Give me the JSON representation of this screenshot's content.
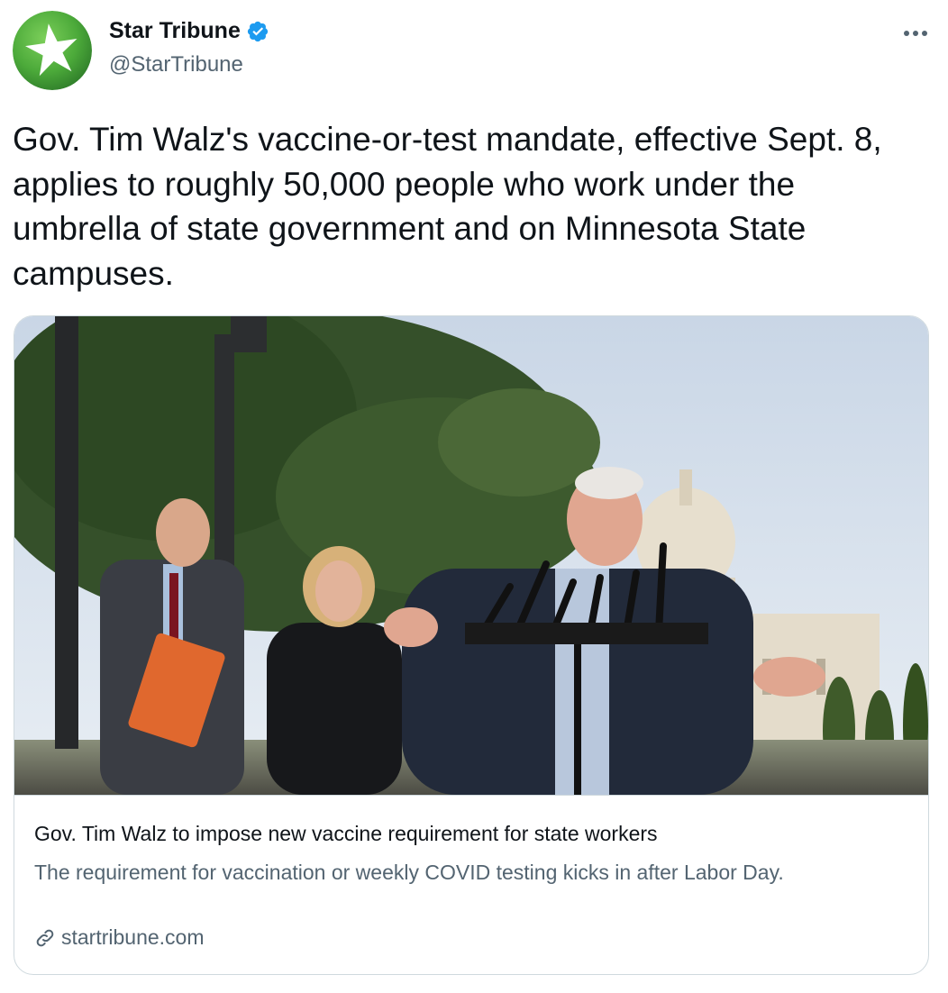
{
  "author": {
    "display_name": "Star Tribune",
    "handle": "@StarTribune",
    "verified": true,
    "avatar_icon": "star-logo-icon"
  },
  "more_icon": "more-dots-icon",
  "tweet": {
    "text": "Gov. Tim Walz's vaccine-or-test mandate, effective Sept. 8, applies to roughly 50,000 people who work under the umbrella of state government and on Minnesota State campuses."
  },
  "card": {
    "image_icon": "news-photo",
    "title": "Gov. Tim Walz to impose new vaccine requirement for state workers",
    "description": "The requirement for vaccination or weekly COVID testing kicks in after Labor Day.",
    "domain": "startribune.com",
    "link_icon": "link-icon"
  },
  "colors": {
    "text_primary": "#0f1419",
    "text_secondary": "#536471",
    "verified": "#1d9bf0",
    "border": "#cfd9de",
    "brand_green": "#4caa3a"
  }
}
